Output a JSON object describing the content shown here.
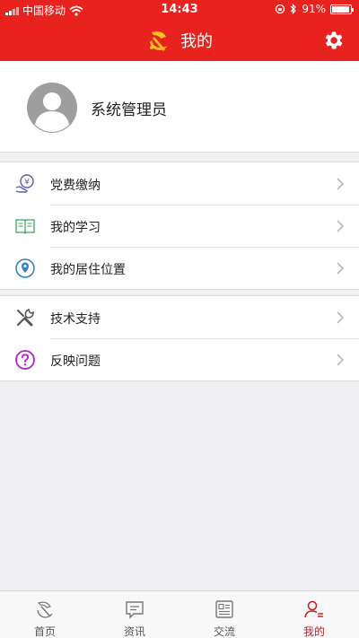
{
  "status_bar": {
    "carrier": "中国移动",
    "time": "14:43",
    "battery": "91%"
  },
  "header": {
    "title": "我的"
  },
  "profile": {
    "name": "系统管理员"
  },
  "menu_groups": [
    {
      "items": [
        {
          "label": "党费缴纳",
          "icon": "yuan-coin-icon"
        },
        {
          "label": "我的学习",
          "icon": "book-icon"
        },
        {
          "label": "我的居住位置",
          "icon": "location-pin-icon"
        }
      ]
    },
    {
      "items": [
        {
          "label": "技术支持",
          "icon": "wrench-screwdriver-icon"
        },
        {
          "label": "反映问题",
          "icon": "question-icon"
        }
      ]
    }
  ],
  "tab_bar": {
    "tabs": [
      {
        "label": "首页",
        "icon": "emblem-icon",
        "active": false
      },
      {
        "label": "资讯",
        "icon": "message-icon",
        "active": false
      },
      {
        "label": "交流",
        "icon": "newspaper-icon",
        "active": false
      },
      {
        "label": "我的",
        "icon": "user-list-icon",
        "active": true
      }
    ]
  },
  "colors": {
    "brand_red": "#e8221f",
    "active_tab": "#c9181e",
    "emblem_gold": "#f4c21a"
  }
}
